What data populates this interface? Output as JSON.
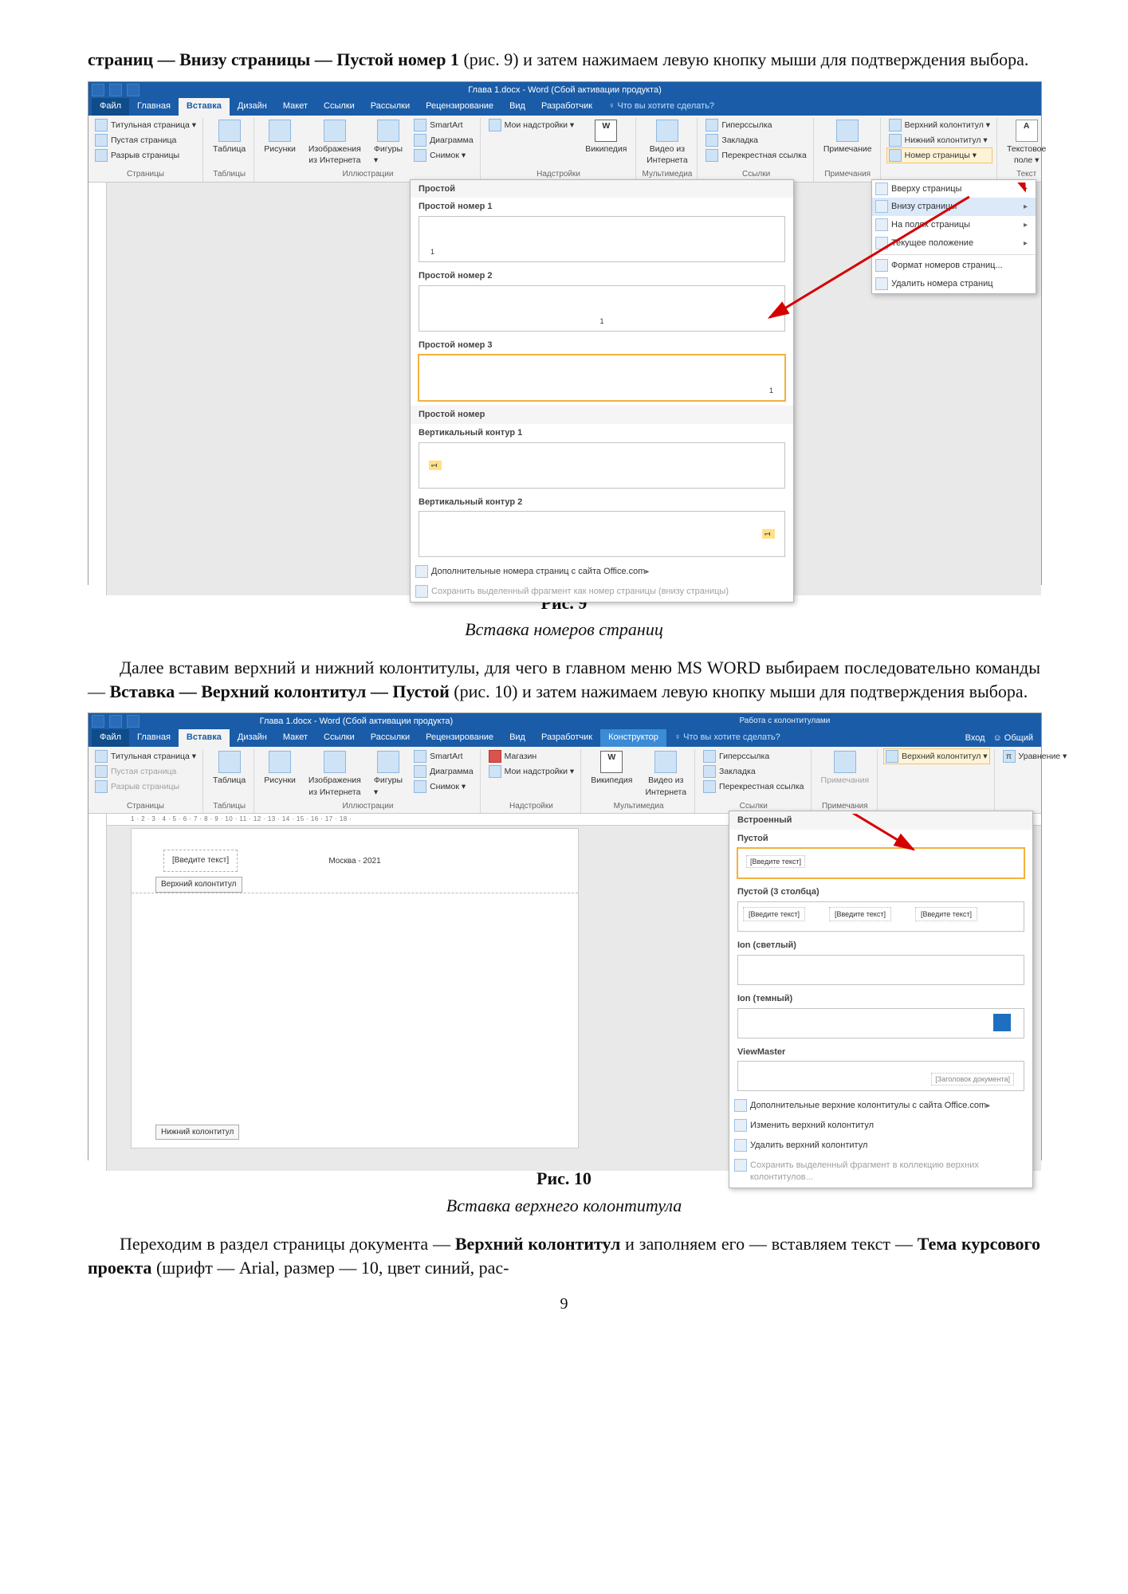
{
  "text": {
    "top_para_a": "страниц — ",
    "top_para_b": "Внизу страницы — Пустой номер 1",
    "top_para_c": " (рис. 9) и затем нажимаем левую кнопку мыши для подтверждения выбора.",
    "fig9_num": "Рис. 9",
    "fig9_cap": "Вставка номеров страниц",
    "mid_para_a": "Далее вставим верхний и нижний колонтитулы, для чего в главном меню MS WORD выбираем последовательно команды — ",
    "mid_para_b": "Вставка — Верхний колонтитул — Пустой",
    "mid_para_c": " (рис. 10) и затем нажимаем левую кнопку мыши для подтверждения выбора.",
    "fig10_num": "Рис. 10",
    "fig10_cap": "Вставка верхнего колонтитула",
    "end_para_a": "Переходим в раздел страницы документа — ",
    "end_para_b": "Верхний колонтитул",
    "end_para_c": " и заполняем его — вставляем текст — ",
    "end_para_d": "Тема курсового проекта",
    "end_para_e": " (шрифт — Arial, размер — 10, цвет синий, рас-",
    "pagenum": "9"
  },
  "shot1": {
    "title": "Глава 1.docx - Word (Сбой активации продукта)",
    "tabs": {
      "file": "Файл",
      "home": "Главная",
      "insert": "Вставка",
      "design": "Дизайн",
      "layout": "Макет",
      "refs": "Ссылки",
      "mail": "Рассылки",
      "review": "Рецензирование",
      "view": "Вид",
      "dev": "Разработчик",
      "tellme": "Что вы хотите сделать?"
    },
    "groups": {
      "pages": {
        "cover": "Титульная страница ▾",
        "blank": "Пустая страница",
        "break": "Разрыв страницы",
        "label": "Страницы"
      },
      "tables": {
        "btn": "Таблица",
        "label": "Таблицы"
      },
      "illus": {
        "pics": "Рисунки",
        "online": "Изображения из Интернета",
        "shapes": "Фигуры ▾",
        "smart": "SmartArt",
        "chart": "Диаграмма",
        "screenshot": "Снимок ▾",
        "label": "Иллюстрации"
      },
      "addins": {
        "myaddins": "Мои надстройки ▾",
        "wiki": "Википедия",
        "label": "Надстройки"
      },
      "media": {
        "video": "Видео из Интернета",
        "label": "Мультимедиа"
      },
      "links": {
        "hyper": "Гиперссылка",
        "bookmark": "Закладка",
        "cross": "Перекрестная ссылка",
        "label": "Ссылки"
      },
      "comments": {
        "btn": "Примечание",
        "label": "Примечания"
      },
      "hf": {
        "header": "Верхний колонтитул ▾",
        "footer": "Нижний колонтитул ▾",
        "pagenum": "Номер страницы ▾",
        "label": ""
      },
      "text": {
        "btn": "Текстовое поле ▾",
        "label": "Текст"
      }
    },
    "pagenum_menu": {
      "top": "Вверху страницы",
      "bottom": "Внизу страницы",
      "margins": "На полях страницы",
      "current": "Текущее положение",
      "format": "Формат номеров страниц...",
      "remove": "Удалить номера страниц"
    },
    "gallery": {
      "head": "Простой",
      "items": [
        "Простой номер 1",
        "Простой номер 2",
        "Простой номер 3",
        "Простой номер",
        "Вертикальный контур 1",
        "Вертикальный контур 2"
      ],
      "more": "Дополнительные номера страниц с сайта Office.com",
      "savesel": "Сохранить выделенный фрагмент как номер страницы (внизу страницы)"
    }
  },
  "shot2": {
    "title": "Глава 1.docx - Word (Сбой активации продукта)",
    "context_title": "Работа с колонтитулами",
    "tabs": {
      "file": "Файл",
      "home": "Главная",
      "insert": "Вставка",
      "design": "Дизайн",
      "layout": "Макет",
      "refs": "Ссылки",
      "mail": "Рассылки",
      "review": "Рецензирование",
      "view": "Вид",
      "dev": "Разработчик",
      "ctor": "Конструктор",
      "tellme": "Что вы хотите сделать?",
      "signin": "Вход",
      "share": "Общий"
    },
    "groups": {
      "pages": {
        "cover": "Титульная страница ▾",
        "blank": "Пустая страница",
        "break": "Разрыв страницы",
        "label": "Страницы"
      },
      "tables": {
        "btn": "Таблица",
        "label": "Таблицы"
      },
      "illus": {
        "pics": "Рисунки",
        "online": "Изображения из Интернета",
        "shapes": "Фигуры ▾",
        "smart": "SmartArt",
        "chart": "Диаграмма",
        "screenshot": "Снимок ▾",
        "label": "Иллюстрации"
      },
      "apps": {
        "store": "Магазин",
        "myaddins": "Мои надстройки ▾",
        "label": "Надстройки"
      },
      "media": {
        "wiki": "Википедия",
        "video": "Видео из Интернета",
        "label": "Мультимедиа"
      },
      "links": {
        "hyper": "Гиперссылка",
        "bookmark": "Закладка",
        "cross": "Перекрестная ссылка",
        "label": "Ссылки"
      },
      "comments": {
        "btn": "Примечания",
        "label": "Примечания"
      },
      "hf": {
        "header": "Верхний колонтитул ▾",
        "label": ""
      },
      "symbols": {
        "eq": "Уравнение ▾",
        "label": ""
      }
    },
    "ruler": "1 · 2 · 3 · 4 · 5 · 6 · 7 · 8 · 9 · 10 · 11 · 12 · 13 · 14 · 15 · 16 · 17 · 18 ·",
    "header_text": "[Введите текст]",
    "header_tag": "Верхний колонтитул",
    "header_center": "Москва - 2021",
    "footer_tag": "Нижний колонтитул",
    "gallery": {
      "builtin": "Встроенный",
      "items": {
        "empty": "Пустой",
        "empty3": "Пустой (3 столбца)",
        "ion_light": "Ion (светлый)",
        "ion_dark": "Ion (темный)",
        "viewmaster": "ViewMaster"
      },
      "col_text": "[Введите текст]",
      "more": "Дополнительные верхние колонтитулы с сайта Office.com",
      "edit": "Изменить верхний колонтитул",
      "remove": "Удалить верхний колонтитул",
      "savesel": "Сохранить выделенный фрагмент в коллекцию верхних колонтитулов..."
    }
  }
}
